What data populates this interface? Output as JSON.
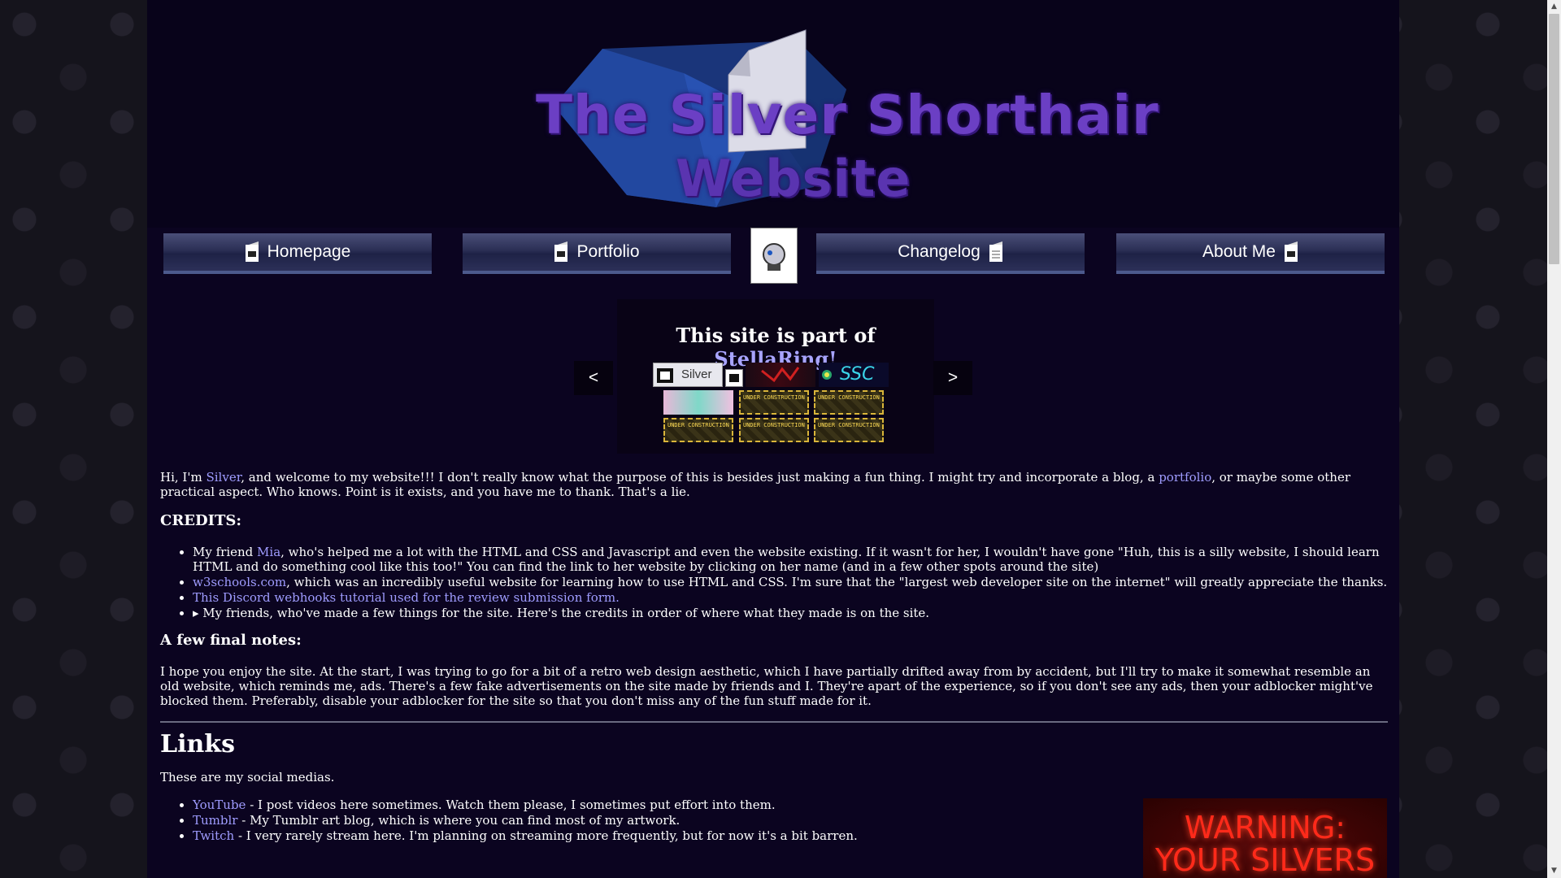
{
  "site": {
    "logo_line1": "The Silver Shorthair",
    "logo_line2": "Website"
  },
  "nav": {
    "homepage": "Homepage",
    "portfolio": "Portfolio",
    "changelog": "Changelog",
    "about": "About Me"
  },
  "webring": {
    "title_prefix": "This site is part of ",
    "ring_name": "StellaRing!",
    "prev": "<",
    "next": ">",
    "silver_badge_text": "Silver",
    "ssc_badge_text": "SSC",
    "under_construction": "UNDER CONSTRUCTION"
  },
  "intro": {
    "p1_a": "Hi, I'm ",
    "p1_link": "Silver",
    "p1_b": ", and welcome to my website!!! I don't really know what the purpose of this is besides just making a fun thing. I might try and incorporate a blog, a ",
    "p1_link2": "portfolio",
    "p1_c": ", or maybe some other practical aspect. Who knows. Point is it exists, and you have me to thank. That's a lie."
  },
  "credits": {
    "heading": "CREDITS:",
    "item1_a": "My friend ",
    "item1_link": "Mia",
    "item1_b": ", who's helped me a lot with the HTML and CSS and Javascript and even the website existing. If it wasn't for her, I wouldn't have gone \"Huh, this is a silly website, I should learn HTML and do something cool like this too!\" You can find the link to her website by clicking on her name (and in a few other spots around the site)",
    "item2_link": "w3schools.com",
    "item2_b": ", which was an incredibly useful website for learning how to use HTML and CSS. I'm sure that the \"largest web developer site on the internet\" will greatly appreciate the thanks.",
    "item3_link": "This Discord webhooks tutorial used for the review submission form.",
    "item4": "▸ My friends, who've made a few things for the site. Here's the credits in order of where what they made is on the site."
  },
  "final_notes": {
    "heading": "A few final notes:",
    "text": "I hope you enjoy the site. At the start, I was trying to go for a bit of a retro web design aesthetic, which I have partially drifted away from by accident, but I'll try to make it somewhat resemble an old website, which reminds me, ads. There's a few fake advertisements on the site made by friends and I. They're apart of the experience, so if you don't see any ads, then your adblocker might've blocked them. Preferably, disable your adblocker for the site so that you don't miss any of the fun stuff made for it."
  },
  "links": {
    "heading": "Links",
    "intro": "These are my social medias.",
    "items": [
      {
        "name": "YouTube",
        "desc": " - I post videos here sometimes. Watch them please, I sometimes put effort into them."
      },
      {
        "name": "Tumblr",
        "desc": " - My Tumblr art blog, which is where you can find most of my artwork."
      },
      {
        "name": "Twitch",
        "desc": " - I very rarely stream here. I'm planning on streaming more frequently, but for now it's a bit barren."
      }
    ]
  },
  "ad": {
    "line1": "WARNING:",
    "line2": "YOUR SILVERS"
  },
  "colors": {
    "page_bg": "#0b0420",
    "header_bg": "#08031a",
    "link": "#9f9cff",
    "logo_purple": "#6b3fc4",
    "nav_gradient_top": "#4a4f78",
    "warning_red": "#ff2a1a"
  },
  "icons": {
    "nav_button_icon": "document-cat-icon",
    "center_icon": "mascot-icon"
  }
}
